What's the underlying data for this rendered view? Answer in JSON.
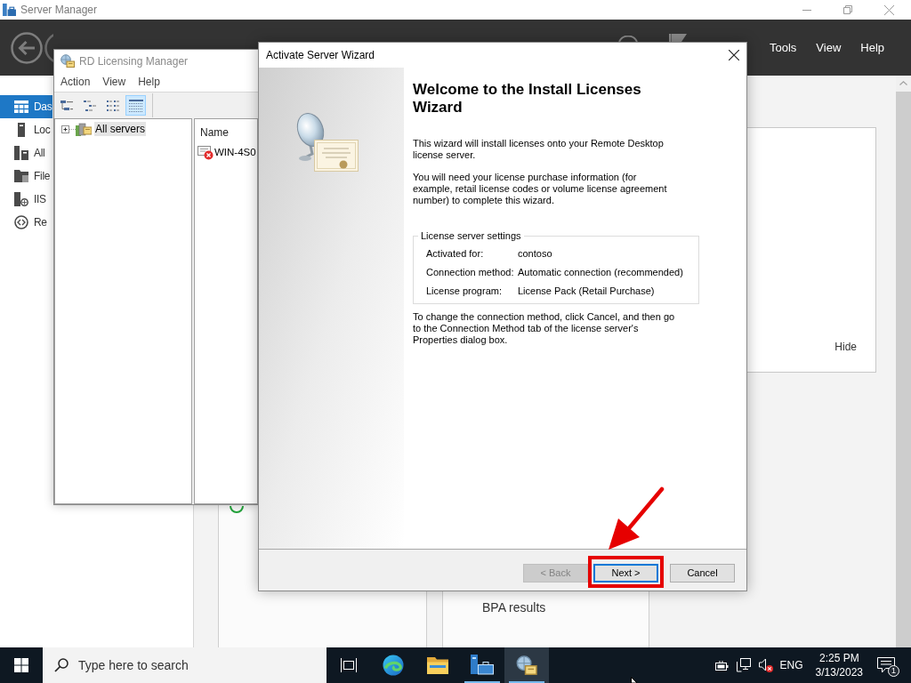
{
  "server_manager": {
    "title": "Server Manager",
    "menu": [
      "Tools",
      "View",
      "Help"
    ],
    "sidebar": [
      {
        "label": "Das",
        "selected": true
      },
      {
        "label": "Loc",
        "selected": false
      },
      {
        "label": "All",
        "selected": false
      },
      {
        "label": "File",
        "selected": false
      },
      {
        "label": "IIS",
        "selected": false
      },
      {
        "label": "Re",
        "selected": false
      }
    ],
    "panel": {
      "link": "Hide"
    },
    "tile": {
      "title": "BPA results"
    }
  },
  "licensing_manager": {
    "title": "RD Licensing Manager",
    "menu": [
      "Action",
      "View",
      "Help"
    ],
    "toolbar": [
      {
        "selected": false
      },
      {
        "selected": false
      },
      {
        "selected": false
      },
      {
        "selected": true
      }
    ],
    "tree": [
      {
        "label": "All servers",
        "expanded": false,
        "selected": true
      }
    ],
    "list": {
      "columns": [
        "Name"
      ],
      "rows": [
        [
          "WIN-4S0"
        ]
      ]
    }
  },
  "wizard": {
    "title": "Activate Server Wizard",
    "heading": "Welcome to the Install Licenses Wizard",
    "paragraphs": [
      "This wizard will install licenses onto your Remote Desktop license server.",
      "You will need your license purchase information (for example, retail license codes or volume license agreement number) to complete this wizard."
    ],
    "settings": {
      "title": "License server settings",
      "rows": [
        {
          "label": "Activated for:",
          "value": "contoso"
        },
        {
          "label": "Connection method:",
          "value": "Automatic connection (recommended)"
        },
        {
          "label": "License program:",
          "value": "License Pack (Retail Purchase)"
        }
      ]
    },
    "note": "To change the connection method, click Cancel, and then go to the Connection Method tab of the license server's Properties dialog box.",
    "buttons": [
      {
        "label": "< Back",
        "disabled": true,
        "default": false,
        "highlighted": false
      },
      {
        "label": "Next >",
        "disabled": false,
        "default": true,
        "highlighted": true
      },
      {
        "label": "Cancel",
        "disabled": false,
        "default": false,
        "highlighted": false
      }
    ]
  },
  "taskbar": {
    "search": {
      "placeholder": "Type here to search"
    },
    "apps": [
      {
        "running": false,
        "selected": false
      },
      {
        "running": false,
        "selected": false
      },
      {
        "running": true,
        "selected": false
      },
      {
        "running": true,
        "selected": true
      }
    ],
    "tray": {
      "muted": true,
      "language": "ENG",
      "time": "2:25 PM",
      "date": "3/13/2023",
      "notifications": "1"
    }
  }
}
